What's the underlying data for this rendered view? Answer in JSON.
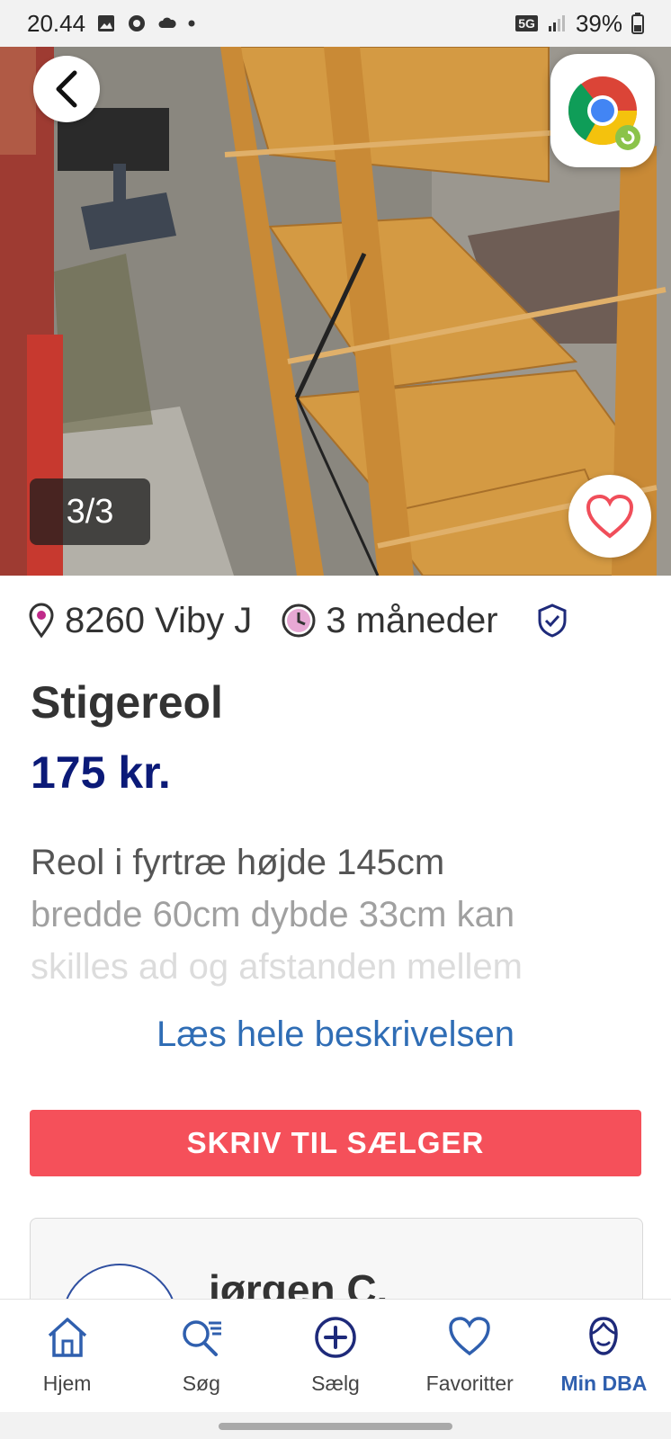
{
  "status_bar": {
    "time": "20.44",
    "network": "5G",
    "battery": "39%"
  },
  "gallery": {
    "counter": "3/3"
  },
  "listing": {
    "location": "8260 Viby J",
    "age": "3 måneder",
    "title": "Stigereol",
    "price": "175 kr.",
    "description_lines": [
      "Reol i fyrtræ højde 145cm",
      "bredde 60cm dybde 33cm kan",
      "skilles ad og afstanden mellem"
    ],
    "read_more": "Læs hele beskrivelsen",
    "contact_button": "SKRIV TIL SÆLGER"
  },
  "seller": {
    "name": "jørgen C."
  },
  "nav": {
    "items": [
      {
        "label": "Hjem",
        "icon": "home-icon"
      },
      {
        "label": "Søg",
        "icon": "search-icon"
      },
      {
        "label": "Sælg",
        "icon": "plus-circle-icon"
      },
      {
        "label": "Favoritter",
        "icon": "heart-icon"
      },
      {
        "label": "Min DBA",
        "icon": "profile-icon"
      }
    ],
    "active": "Min DBA"
  },
  "colors": {
    "price": "#0b1a78",
    "cta": "#f5505a",
    "link": "#2f6db5",
    "nav_active": "#2f5fae"
  }
}
